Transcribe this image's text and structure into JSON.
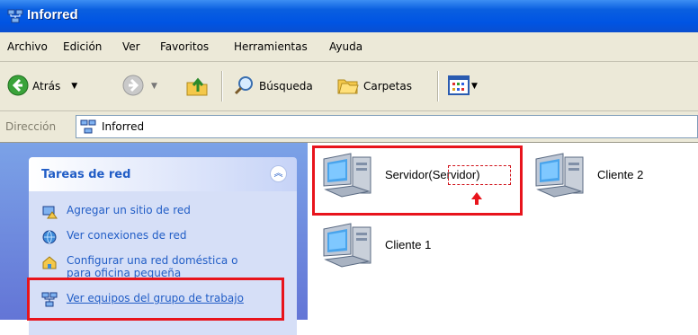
{
  "window": {
    "title": "Inforred"
  },
  "menu": [
    "Archivo",
    "Edición",
    "Ver",
    "Favoritos",
    "Herramientas",
    "Ayuda"
  ],
  "toolbar": {
    "back_label": "Atrás",
    "search_label": "Búsqueda",
    "folders_label": "Carpetas"
  },
  "address": {
    "label": "Dirección",
    "value": "Inforred"
  },
  "tasks_panel": {
    "title": "Tareas de red",
    "items": [
      {
        "label": "Agregar un sitio de red",
        "icon": "add-network-place-icon"
      },
      {
        "label": "Ver conexiones de red",
        "icon": "network-connections-icon"
      },
      {
        "label": "Configurar una red doméstica o para oficina pequeña",
        "line1": "Configurar una red doméstica o",
        "line2": "para oficina pequeña",
        "icon": "home-network-setup-icon"
      },
      {
        "label": "Ver equipos del grupo de trabajo",
        "icon": "workgroup-computers-icon"
      }
    ]
  },
  "computers": [
    {
      "name": "Servidor",
      "annotation": "Servidor"
    },
    {
      "name": "Cliente 2"
    },
    {
      "name": "Cliente 1"
    }
  ],
  "colors": {
    "link": "#215dc6",
    "highlight": "#e8141c",
    "titlebar": "#0054e3"
  }
}
